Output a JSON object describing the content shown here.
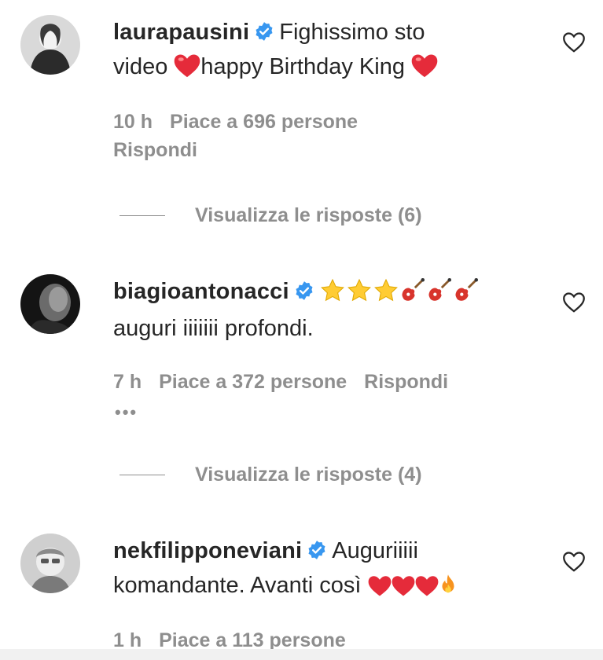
{
  "comments": [
    {
      "username": "laurapausini",
      "text_a": "Fighissimo sto",
      "text_b": "video",
      "text_c": "happy Birthday King",
      "time": "10 h",
      "likes": "Piace a 696 persone",
      "reply": "Rispondi",
      "view_replies": "Visualizza le risposte (6)"
    },
    {
      "username": "biagioantonacci",
      "text_b": "auguri iiiiiii profondi.",
      "time": "7 h",
      "likes": "Piace a 372 persone",
      "reply": "Rispondi",
      "more": "•••",
      "view_replies": "Visualizza le risposte (4)"
    },
    {
      "username": "nekfilipponeviani",
      "text_a": "Auguriiiii",
      "text_b": "komandante. Avanti così",
      "time": "1 h",
      "likes": "Piace a 113 persone"
    }
  ],
  "colors": {
    "verified": "#3897f0",
    "heart": "#e0245e",
    "meta": "#8e8e8e"
  },
  "icons": [
    "verified-badge-icon",
    "heart-outline-icon",
    "red-heart-emoji",
    "star-emoji",
    "guitar-emoji",
    "fire-emoji"
  ]
}
